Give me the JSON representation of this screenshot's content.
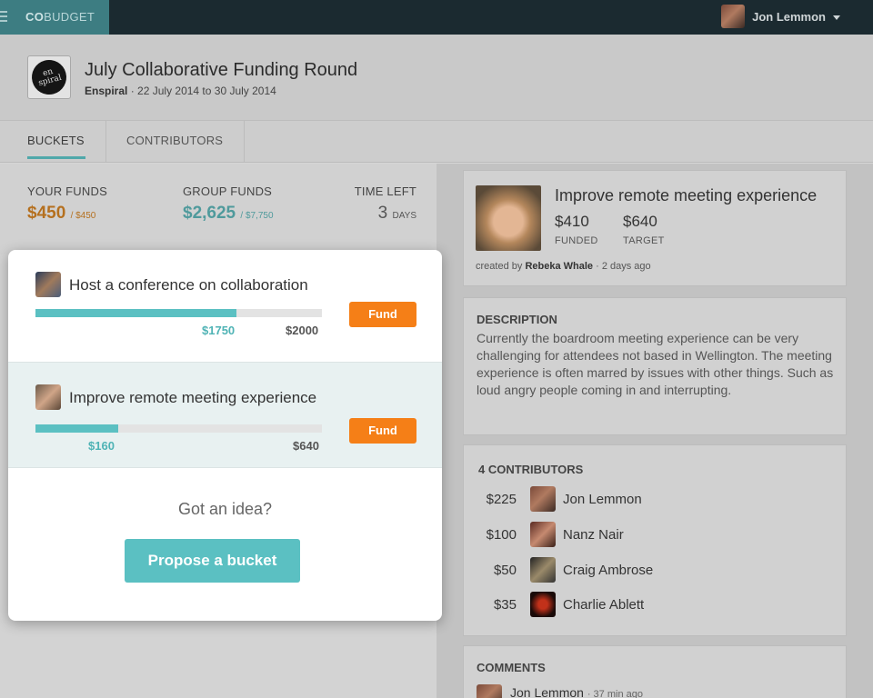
{
  "app": {
    "brand_bold": "CO",
    "brand_rest": "BUDGET"
  },
  "user": {
    "name": "Jon Lemmon"
  },
  "round": {
    "title": "July Collaborative Funding Round",
    "org": "Enspiral",
    "dates": "22 July 2014 to 30 July 2014",
    "logo_text": "en spiral"
  },
  "tabs": [
    "BUCKETS",
    "CONTRIBUTORS"
  ],
  "stats": {
    "your_funds_label": "YOUR FUNDS",
    "your_funds_value": "$450",
    "your_funds_total": "/ $450",
    "group_funds_label": "GROUP FUNDS",
    "group_funds_value": "$2,625",
    "group_funds_total": "/ $7,750",
    "time_left_label": "TIME LEFT",
    "time_left_value": "3",
    "time_left_unit": "DAYS"
  },
  "buckets": [
    {
      "name": "Host a conference on collaboration",
      "current": "$1750",
      "goal": "$2000",
      "progress": 0.7,
      "fund_label": "Fund"
    },
    {
      "name": "Improve remote meeting experience",
      "current": "$160",
      "goal": "$640",
      "progress": 0.29,
      "fund_label": "Fund"
    }
  ],
  "idea": {
    "prompt": "Got an idea?",
    "button": "Propose a bucket"
  },
  "detail": {
    "title": "Improve remote meeting experience",
    "funded_value": "$410",
    "funded_label": "FUNDED",
    "target_value": "$640",
    "target_label": "TARGET",
    "created_prefix": "created by",
    "creator": "Rebeka Whale",
    "created_ago": "· 2 days ago",
    "description_label": "DESCRIPTION",
    "description": "Currently the boardroom meeting experience can be very challenging for attendees not based in Wellington.  The meeting experience is often marred by issues with other things. Such as loud angry people coming in and interrupting.",
    "contributors_label": "4 CONTRIBUTORS",
    "contributors": [
      {
        "amount": "$225",
        "name": "Jon Lemmon"
      },
      {
        "amount": "$100",
        "name": "Nanz Nair"
      },
      {
        "amount": "$50",
        "name": "Craig Ambrose"
      },
      {
        "amount": "$35",
        "name": "Charlie Ablett"
      }
    ],
    "comments_label": "COMMENTS",
    "comment_author": "Jon Lemmon",
    "comment_ago": "· 37 min ago"
  },
  "colors": {
    "accent": "#5bc0c2",
    "fund": "#f57f17",
    "topbar": "#1b2a30"
  }
}
